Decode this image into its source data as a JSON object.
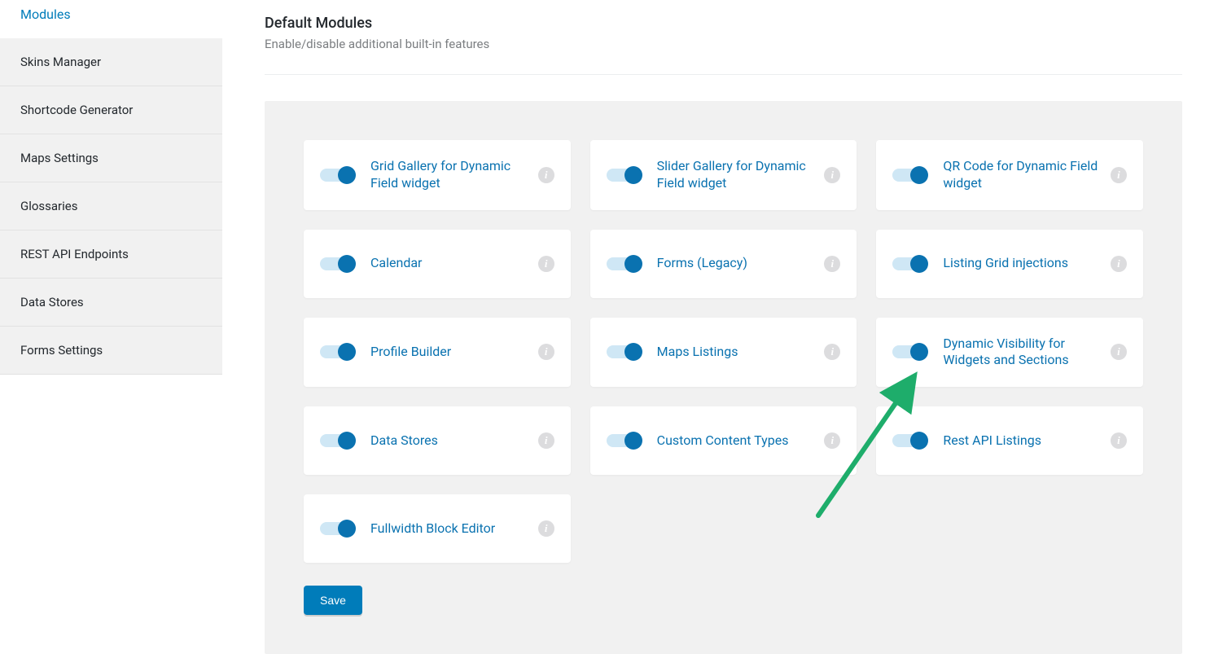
{
  "sidebar": {
    "active_label": "Modules",
    "items": [
      "Skins Manager",
      "Shortcode Generator",
      "Maps Settings",
      "Glossaries",
      "REST API Endpoints",
      "Data Stores",
      "Forms Settings"
    ]
  },
  "header": {
    "title": "Default Modules",
    "subtitle": "Enable/disable additional built-in features"
  },
  "modules": [
    {
      "label": "Grid Gallery for Dynamic Field widget",
      "enabled": true
    },
    {
      "label": "Slider Gallery for Dynamic Field widget",
      "enabled": true
    },
    {
      "label": "QR Code for Dynamic Field widget",
      "enabled": true
    },
    {
      "label": "Calendar",
      "enabled": true
    },
    {
      "label": "Forms (Legacy)",
      "enabled": true
    },
    {
      "label": "Listing Grid injections",
      "enabled": true
    },
    {
      "label": "Profile Builder",
      "enabled": true
    },
    {
      "label": "Maps Listings",
      "enabled": true
    },
    {
      "label": "Dynamic Visibility for Widgets and Sections",
      "enabled": true
    },
    {
      "label": "Data Stores",
      "enabled": true
    },
    {
      "label": "Custom Content Types",
      "enabled": true
    },
    {
      "label": "Rest API Listings",
      "enabled": true
    },
    {
      "label": "Fullwidth Block Editor",
      "enabled": true
    }
  ],
  "buttons": {
    "save": "Save"
  },
  "annotation": {
    "target_module_index": 8
  }
}
